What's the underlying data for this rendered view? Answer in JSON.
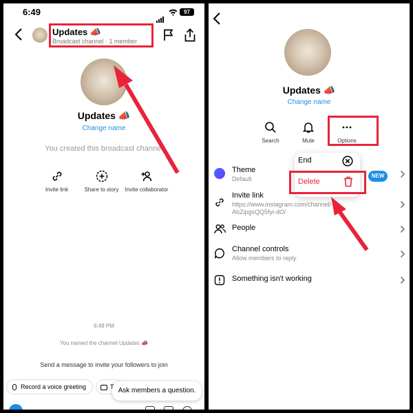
{
  "status_bar": {
    "time": "6:49",
    "battery": "97"
  },
  "left": {
    "header": {
      "title": "Updates 📣",
      "subtitle": "Broadcast channel · 1 member"
    },
    "channel_name": "Updates 📣",
    "change_name": "Change name",
    "created_text": "You created this broadcast channel",
    "actions": [
      {
        "label": "Invite link",
        "icon": "link-icon"
      },
      {
        "label": "Share to story",
        "icon": "add-story-icon"
      },
      {
        "label": "Invite collaborator",
        "icon": "add-person-icon"
      }
    ],
    "timestamp": "6:48 PM",
    "named_notice": "You named the channel Updates 📣",
    "invite_message": "Send a message to invite your followers to join",
    "chips": {
      "voice": "Record a voice greeting",
      "camera_partial": "T"
    },
    "ask_button": "Ask members a question."
  },
  "right": {
    "channel_name": "Updates 📣",
    "change_name": "Change name",
    "actions": [
      {
        "label": "Search",
        "icon": "search-icon"
      },
      {
        "label": "Mute",
        "icon": "bell-icon"
      },
      {
        "label": "Options",
        "icon": "more-icon"
      }
    ],
    "options_menu": {
      "end": "End",
      "delete": "Delete"
    },
    "settings": {
      "theme": {
        "label": "Theme",
        "value": "Default",
        "badge": "NEW"
      },
      "invite": {
        "label": "Invite link",
        "url_line1": "https://www.instagram.com/channel/",
        "url_line2": "AbZipgsQQ5fyi-dO/"
      },
      "people": {
        "label": "People"
      },
      "controls": {
        "label": "Channel controls",
        "sub": "Allow members to reply"
      },
      "report": {
        "label": "Something isn't working"
      }
    }
  },
  "colors": {
    "highlight": "#e8233a",
    "link": "#1a8fe3"
  }
}
